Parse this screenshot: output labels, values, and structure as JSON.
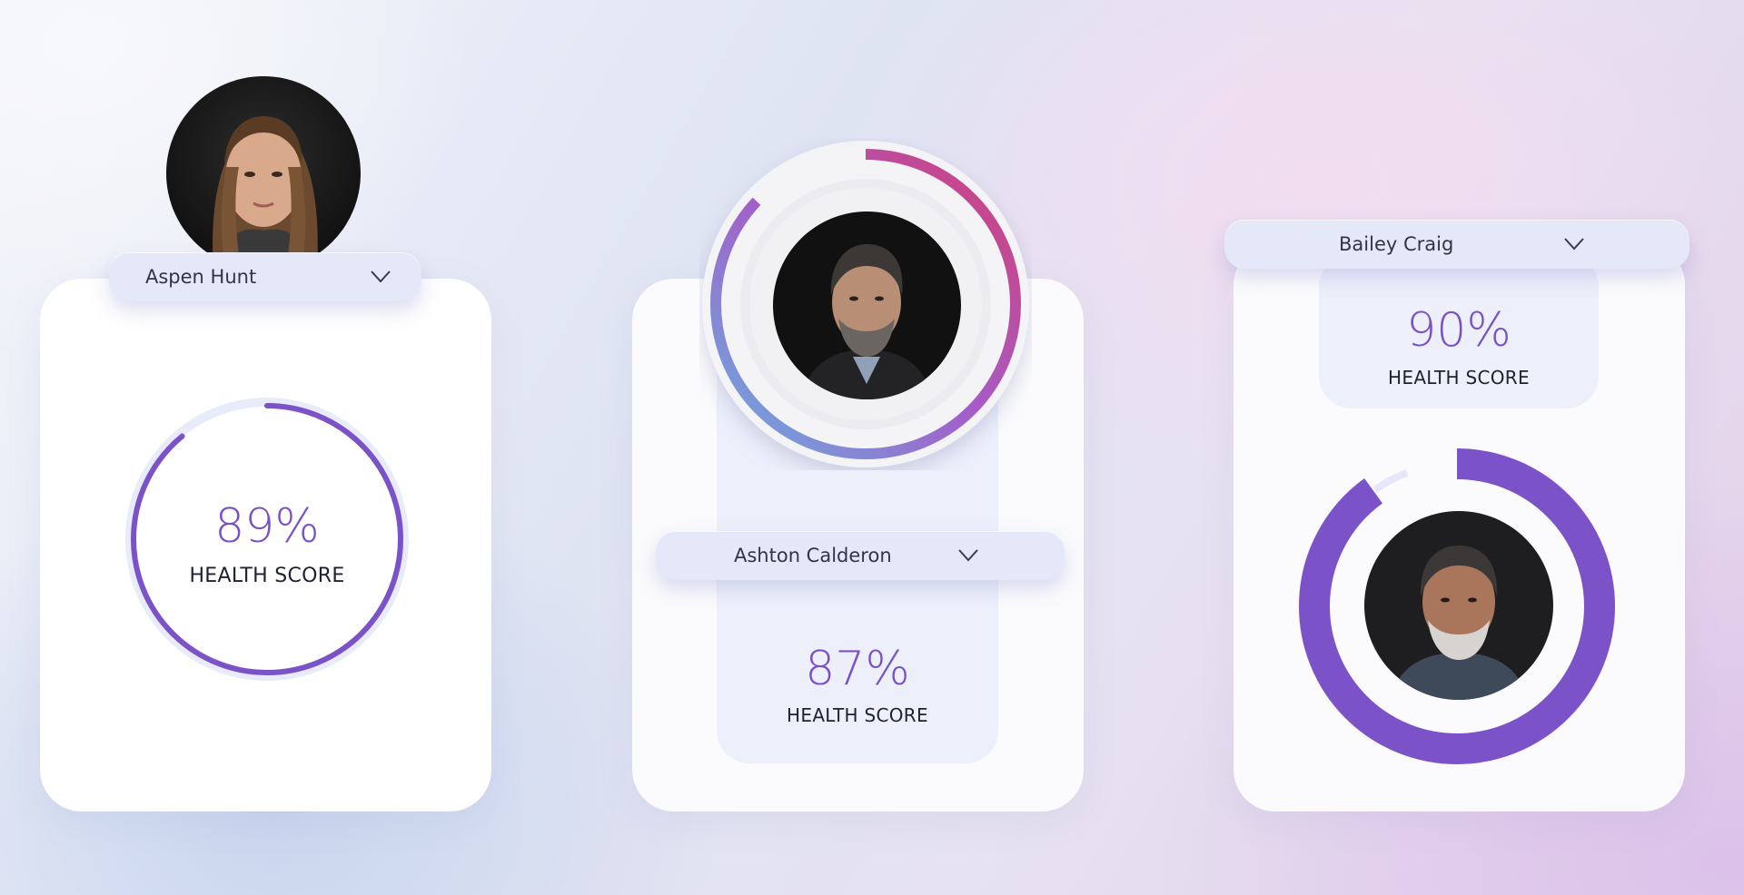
{
  "profiles": [
    {
      "name": "Aspen Hunt",
      "score_text": "89%",
      "score_label": "HEALTH SCORE",
      "score": 0.89
    },
    {
      "name": "Ashton Calderon",
      "score_text": "87%",
      "score_label": "HEALTH SCORE",
      "score": 0.87
    },
    {
      "name": "Bailey Craig",
      "score_text": "90%",
      "score_label": "HEALTH SCORE",
      "score": 0.9
    }
  ],
  "icons": {
    "dropdown": "chevron-down-icon",
    "avatar": "avatar-photo"
  },
  "colors": {
    "accent": "#7a52c7",
    "ring_purple": "#7b52c8",
    "ring_track": "#e4e8f8",
    "gradient_start": "#6aaee0",
    "gradient_mid": "#a55cc8",
    "gradient_end": "#d23f78"
  }
}
